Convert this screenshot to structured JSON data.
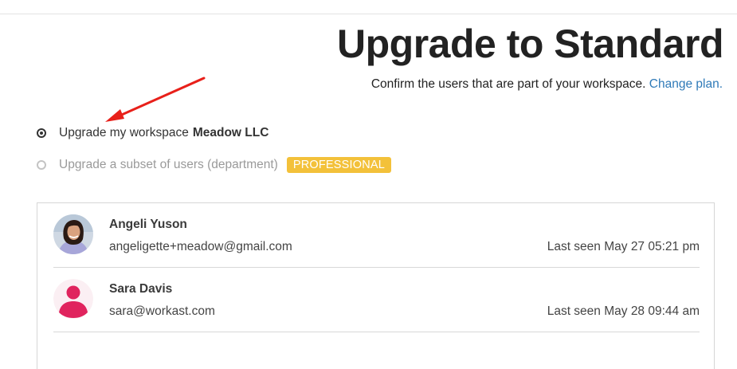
{
  "header": {
    "title": "Upgrade to Standard",
    "subtitle": "Confirm the users that are part of your workspace.",
    "change_plan_link": "Change plan."
  },
  "options": {
    "workspace": {
      "label": "Upgrade my workspace",
      "workspace_name": "Meadow LLC",
      "selected": true
    },
    "subset": {
      "label": "Upgrade a subset of users (department)",
      "badge": "PROFESSIONAL",
      "selected": false
    }
  },
  "users": [
    {
      "name": "Angeli Yuson",
      "email": "angeligette+meadow@gmail.com",
      "last_seen": "Last seen May 27 05:21 pm",
      "avatar": "user-photo"
    },
    {
      "name": "Sara Davis",
      "email": "sara@workast.com",
      "last_seen": "Last seen May 28 09:44 am",
      "avatar": "default-user-icon"
    }
  ],
  "colors": {
    "link": "#2f7ab8",
    "badge": "#f3c13a",
    "annotation_arrow": "#e8201a",
    "default_avatar": "#e0245e"
  }
}
